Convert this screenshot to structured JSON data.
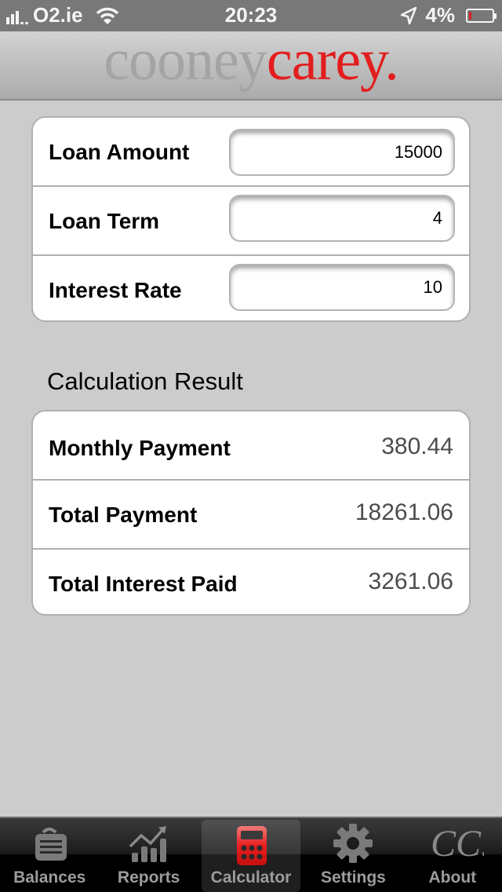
{
  "status_bar": {
    "carrier": "O2.ie",
    "time": "20:23",
    "battery_percent": "4%",
    "battery_level": 0.04,
    "signal_bars": 3
  },
  "header": {
    "logo_part1": "cooney",
    "logo_part2": "carey."
  },
  "inputs": [
    {
      "label": "Loan Amount",
      "value": "15000"
    },
    {
      "label": "Loan Term",
      "value": "4"
    },
    {
      "label": "Interest Rate",
      "value": "10"
    }
  ],
  "results": {
    "title": "Calculation Result",
    "rows": [
      {
        "label": "Monthly Payment",
        "value": "380.44"
      },
      {
        "label": "Total Payment",
        "value": "18261.06"
      },
      {
        "label": "Total Interest Paid",
        "value": "3261.06"
      }
    ]
  },
  "tabs": [
    {
      "label": "Balances",
      "icon": "briefcase-icon",
      "active": false
    },
    {
      "label": "Reports",
      "icon": "chart-icon",
      "active": false
    },
    {
      "label": "Calculator",
      "icon": "calculator-icon",
      "active": true
    },
    {
      "label": "Settings",
      "icon": "gear-icon",
      "active": false
    },
    {
      "label": "About",
      "icon": "cc-logo-icon",
      "active": false
    }
  ],
  "colors": {
    "brand_red": "#e31d1d",
    "brand_gray": "#a4a4a4"
  }
}
